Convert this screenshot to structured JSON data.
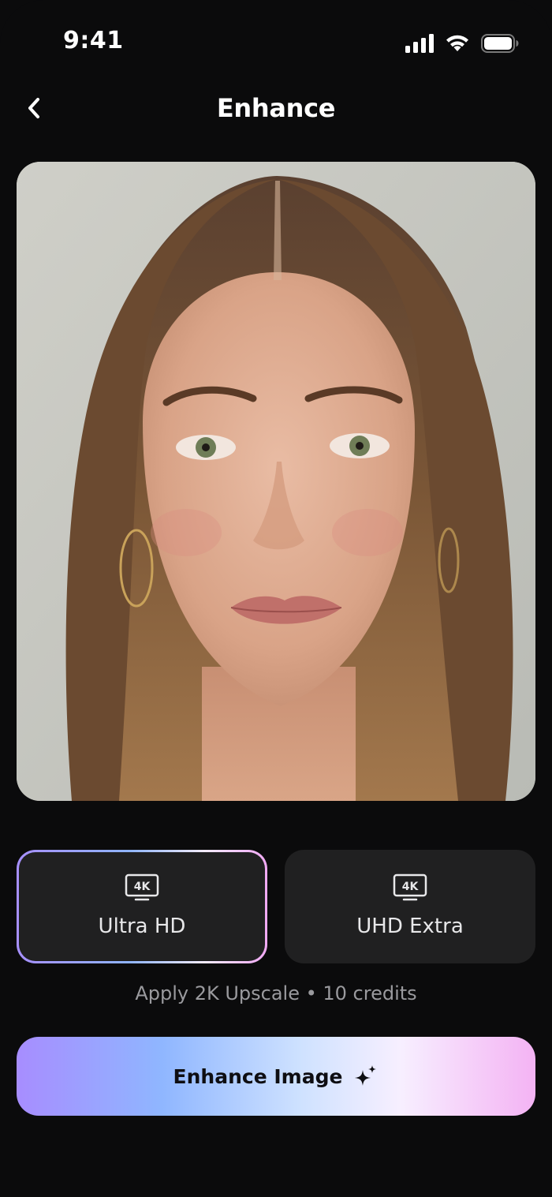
{
  "status_bar": {
    "time": "9:41",
    "icons": [
      "signal-icon",
      "wifi-icon",
      "battery-icon"
    ]
  },
  "header": {
    "back_icon": "chevron-left-icon",
    "title": "Enhance"
  },
  "photo": {
    "subject": "portrait-photo"
  },
  "options": [
    {
      "icon": "4k-tv-icon",
      "icon_text": "4K",
      "label": "Ultra HD",
      "selected": true
    },
    {
      "icon": "4k-tv-icon",
      "icon_text": "4K",
      "label": "UHD Extra",
      "selected": false
    }
  ],
  "credits_note": "Apply 2K Upscale • 10 credits",
  "primary_action": {
    "label": "Enhance Image",
    "icon": "sparkle-icon"
  },
  "colors": {
    "background": "#0b0b0c",
    "card": "#202021",
    "accent_gradient": [
      "#a78dff",
      "#8fb6ff",
      "#cfe2ff",
      "#f7efff",
      "#f4b3f4"
    ]
  }
}
